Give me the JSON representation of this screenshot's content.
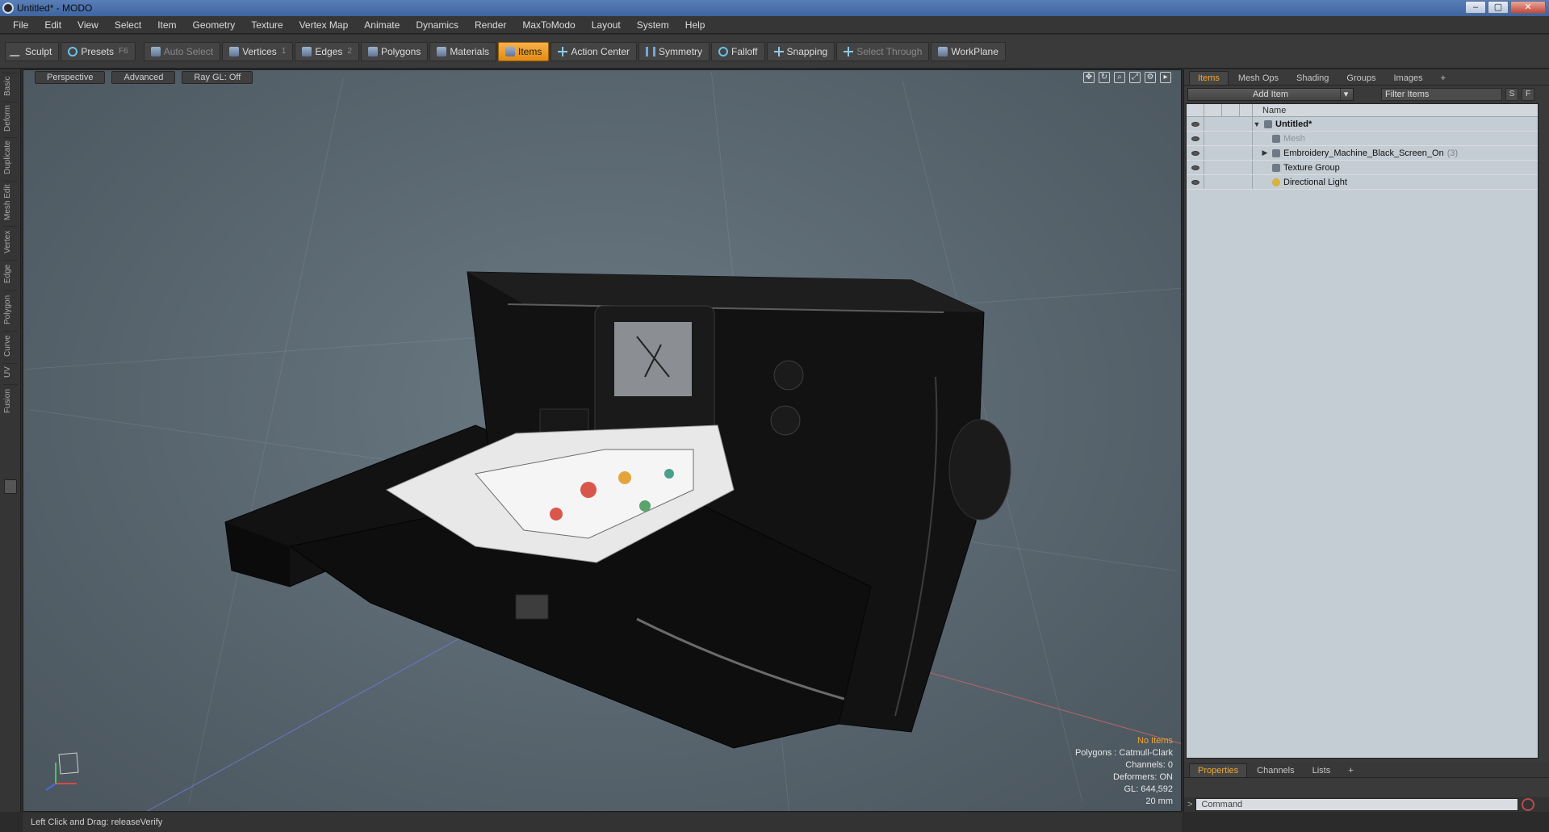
{
  "window": {
    "title": "Untitled* - MODO",
    "controls": [
      "–",
      "▢",
      "✕"
    ]
  },
  "menu": [
    "File",
    "Edit",
    "View",
    "Select",
    "Item",
    "Geometry",
    "Texture",
    "Vertex Map",
    "Animate",
    "Dynamics",
    "Render",
    "MaxToModo",
    "Layout",
    "System",
    "Help"
  ],
  "toolbar": {
    "sculpt": "Sculpt",
    "presets": "Presets",
    "presets_key": "F6",
    "auto_select": "Auto Select",
    "vertices": "Vertices",
    "vertices_key": "1",
    "edges": "Edges",
    "edges_key": "2",
    "polygons": "Polygons",
    "materials": "Materials",
    "items": "Items",
    "action_center": "Action Center",
    "symmetry": "Symmetry",
    "falloff": "Falloff",
    "snapping": "Snapping",
    "select_through": "Select Through",
    "workplane": "WorkPlane"
  },
  "left_tabs": [
    "Basic",
    "Deform",
    "Duplicate",
    "Mesh Edit",
    "Vertex",
    "Edge",
    "Polygon",
    "Curve",
    "UV",
    "Fusion"
  ],
  "viewport": {
    "tabs": [
      "Perspective",
      "Advanced",
      "Ray GL: Off"
    ],
    "info": {
      "selection": "No Items",
      "polygons": "Polygons : Catmull-Clark",
      "channels": "Channels: 0",
      "deformers": "Deformers: ON",
      "gl": "GL: 644,592",
      "scale": "20 mm"
    }
  },
  "right_panel": {
    "tabs": [
      "Items",
      "Mesh Ops",
      "Shading",
      "Groups",
      "Images",
      "+"
    ],
    "add_item": "Add Item",
    "filter_placeholder": "Filter Items",
    "btn_s": "S",
    "btn_f": "F",
    "list_header": "Name",
    "items": [
      {
        "name": "Untitled*",
        "count": ""
      },
      {
        "name": "Mesh",
        "count": ""
      },
      {
        "name": "Embroidery_Machine_Black_Screen_On",
        "count": "(3)"
      },
      {
        "name": "Texture Group",
        "count": ""
      },
      {
        "name": "Directional Light",
        "count": ""
      }
    ],
    "bottom_tabs": [
      "Properties",
      "Channels",
      "Lists",
      "+"
    ],
    "command_placeholder": "Command"
  },
  "status": {
    "text": "Left Click and Drag:  releaseVerify"
  },
  "colors": {
    "accent": "#f0a62c",
    "viewport_bg": "#5e6b74",
    "list_bg": "#c4ccd4"
  }
}
